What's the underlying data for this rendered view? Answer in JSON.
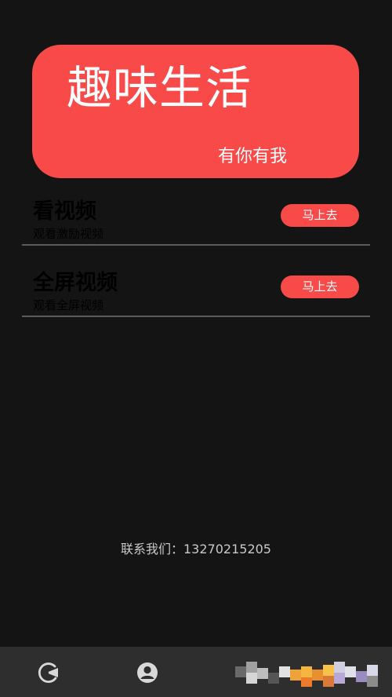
{
  "banner": {
    "title": "趣味生活",
    "subtitle": "有你有我"
  },
  "tasks": [
    {
      "title": "看视频",
      "desc": "观看激励视频",
      "button": "马上去"
    },
    {
      "title": "全屏视频",
      "desc": "观看全屏视频",
      "button": "马上去"
    }
  ],
  "contact": {
    "text": "联系我们：13270215205"
  },
  "nav": {
    "items": [
      {
        "icon": "home-pie-icon"
      },
      {
        "icon": "user-icon"
      },
      {
        "icon": "pixelated-icon"
      }
    ]
  },
  "colors": {
    "accent": "#f94a4a",
    "background": "#141414",
    "nav_background": "#2e2e2e"
  }
}
